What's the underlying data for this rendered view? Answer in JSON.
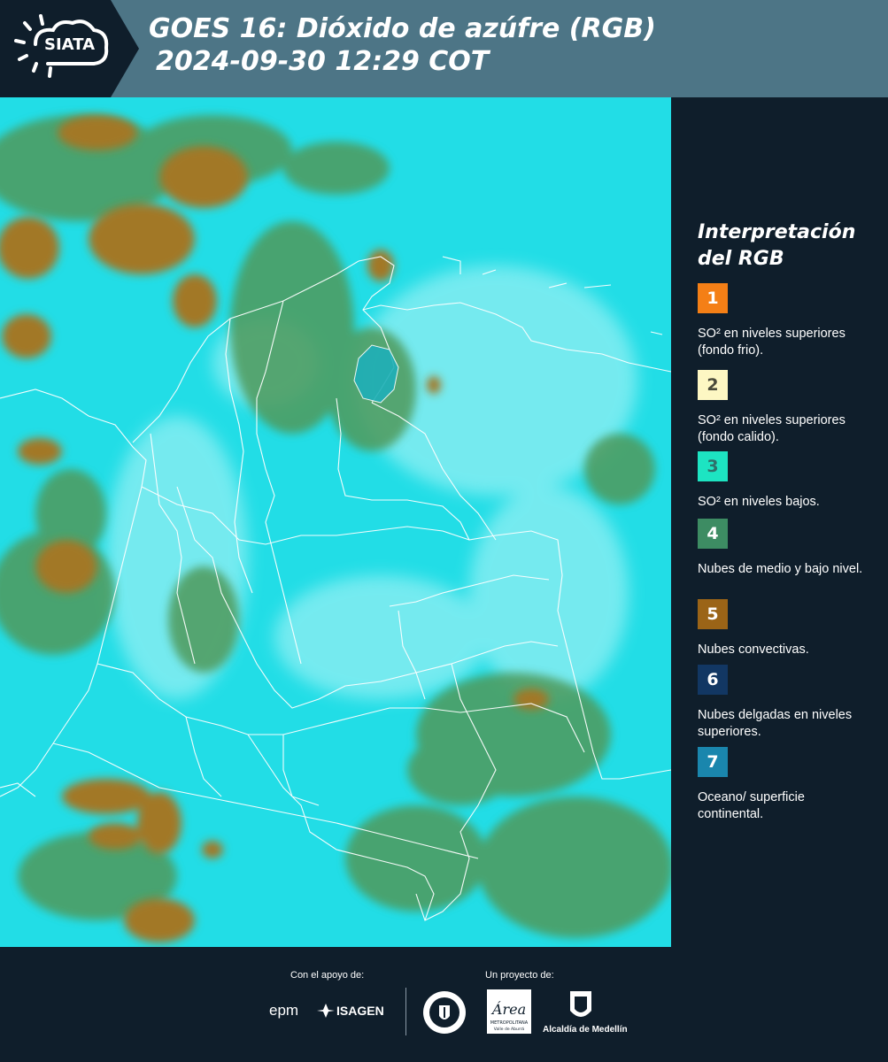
{
  "header": {
    "logo_text": "SIATA",
    "title_line1": "GOES 16: Dióxido de azúfre (RGB)",
    "title_line2": "2024-09-30 12:29 COT"
  },
  "legend": {
    "title_line1": "Interpretación",
    "title_line2": "del RGB",
    "items": [
      {
        "number": "1",
        "color": "#f47f16",
        "text_color": "#ffffff",
        "label": "SO² en niveles superiores (fondo frio)."
      },
      {
        "number": "2",
        "color": "#fdf7c3",
        "text_color": "#4a4a3a",
        "label": "SO² en niveles superiores (fondo calido)."
      },
      {
        "number": "3",
        "color": "#1de4c2",
        "text_color": "#2f6f6a",
        "label": "SO² en niveles bajos."
      },
      {
        "number": "4",
        "color": "#3d8c63",
        "text_color": "#ffffff",
        "label": "Nubes de medio y bajo nivel."
      },
      {
        "number": "5",
        "color": "#9b6417",
        "text_color": "#ffffff",
        "label": "Nubes convectivas."
      },
      {
        "number": "6",
        "color": "#123763",
        "text_color": "#ffffff",
        "label": "Nubes delgadas en niveles superiores."
      },
      {
        "number": "7",
        "color": "#1a86ad",
        "text_color": "#ffffff",
        "label": "Oceano/ superficie continental."
      }
    ]
  },
  "footer": {
    "support_caption": "Con el apoyo de:",
    "project_caption": "Un proyecto de:",
    "sponsor_epm": "epm",
    "sponsor_isagen": "ISAGEN",
    "area_logo_text": "Área",
    "area_subtext": "METROPOLITANA",
    "area_subtext2": "Valle de Aburrá",
    "alcaldia": "Alcaldía de Medellín"
  },
  "map_colors": {
    "cyan_background": "#20dfe8",
    "green_clouds": "#4f9a5c",
    "brown_clouds": "#a07a2a",
    "border_lines": "#ffffff"
  }
}
